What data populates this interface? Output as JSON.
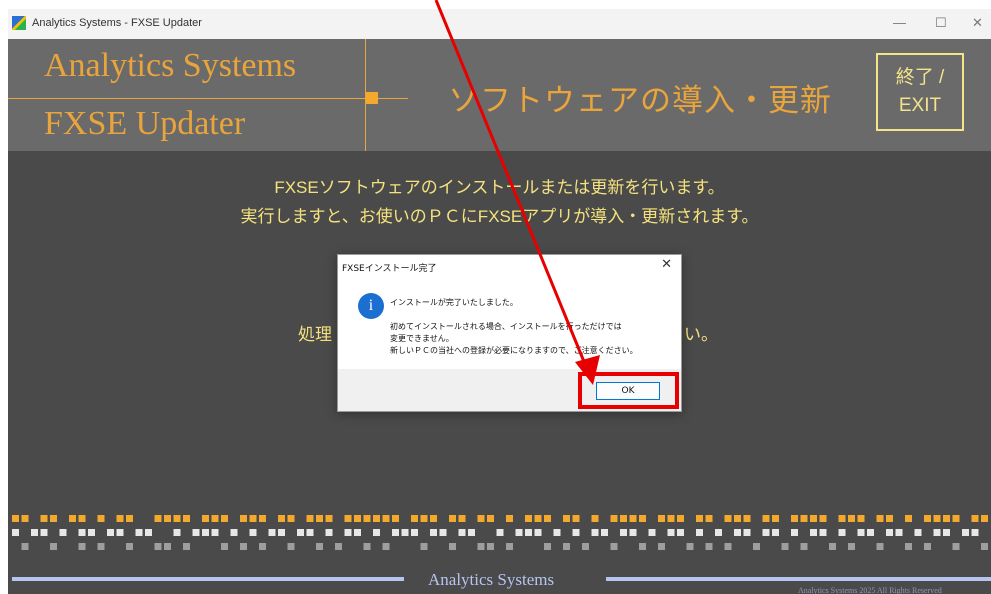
{
  "window": {
    "title": "Analytics Systems - FXSE Updater",
    "minimize": "—",
    "maximize": "☐",
    "close": "✕"
  },
  "header": {
    "brand_line1": "Analytics Systems",
    "brand_line2": "FXSE Updater",
    "subtitle": "ソフトウェアの導入・更新",
    "exit_line1": "終了 /",
    "exit_line2": "EXIT"
  },
  "main": {
    "line1": "FXSEソフトウェアのインストールまたは更新を行います。",
    "line2": "実行しますと、お使いのＰＣにFXSEアプリが導入・更新されます。",
    "processing_left": "処理",
    "processing_right": "い。"
  },
  "dialog": {
    "title": "FXSEインストール完了",
    "close": "✕",
    "icon": "i",
    "message_main": "インストールが完了いたしました。",
    "message_lines": [
      "初めてインストールされる場合、インストールを行っただけでは",
      "変更できません。",
      "新しいＰＣの当社への登録が必要になりますので、ご注意ください。"
    ],
    "ok_label": "OK"
  },
  "footer": {
    "brand": "Analytics Systems",
    "copyright": "Analytics Systems 2025 All Rights Reserved"
  },
  "colors": {
    "accent": "#e9a43c",
    "highlight": "#e80000",
    "arrow": "#e80000"
  },
  "icons": [
    "app-icon",
    "info-icon",
    "close-icon"
  ]
}
